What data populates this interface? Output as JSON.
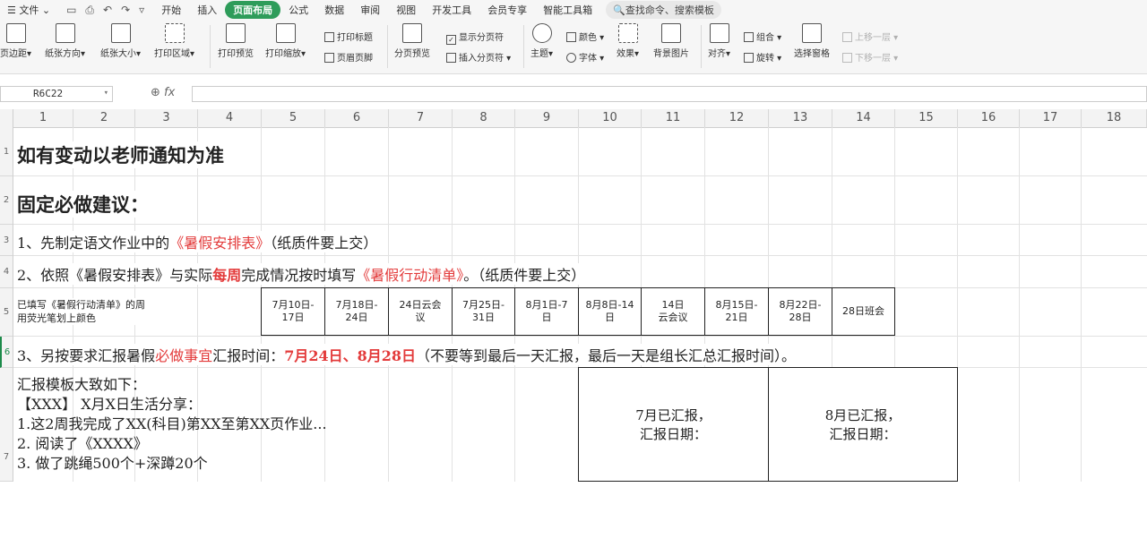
{
  "menu": {
    "file_label": "☰ 文件 ⌄",
    "tabs": [
      "开始",
      "插入",
      "页面布局",
      "公式",
      "数据",
      "审阅",
      "视图",
      "开发工具",
      "会员专享",
      "智能工具箱"
    ],
    "active_tab_index": 2,
    "search_label": "查找命令、搜索模板"
  },
  "ribbon": {
    "margins": "页边距",
    "orientation": "纸张方向",
    "size": "纸张大小",
    "print_area": "打印区域",
    "print_preview": "打印预览",
    "print_scale": "打印缩放",
    "print_titles": "打印标题",
    "header_footer": "页眉页脚",
    "page_break_preview": "分页预览",
    "show_page_breaks": "显示分页符",
    "insert_page_break": "插入分页符",
    "theme": "主题",
    "colors": "颜色",
    "fonts": "字体",
    "effects": "效果",
    "background": "背景图片",
    "align": "对齐",
    "group": "组合",
    "rotate": "旋转",
    "selection_pane": "选择窗格",
    "bring_forward": "上移一层",
    "send_backward": "下移一层"
  },
  "formula_bar": {
    "name_box": "R6C22",
    "fx_label": "fx",
    "formula": ""
  },
  "columns": [
    "1",
    "2",
    "3",
    "4",
    "5",
    "6",
    "7",
    "8",
    "9",
    "10",
    "11",
    "12",
    "13",
    "14",
    "15",
    "16",
    "17",
    "18"
  ],
  "rows": [
    "1",
    "2",
    "3",
    "4",
    "5",
    "6",
    "7"
  ],
  "selected_row": "6",
  "sheet": {
    "r1": "如有变动以老师通知为准",
    "r2": "固定必做建议：",
    "r3_a": "1、先制定语文作业中的",
    "r3_b": "《暑假安排表》",
    "r3_c": "（纸质件要上交）",
    "r4_a": "2、依照《暑假安排表》与实际",
    "r4_b": "每周",
    "r4_c": "完成情况按时填写",
    "r4_d": "《暑假行动清单》",
    "r4_e": "。（纸质件要上交）",
    "r5_label_1": "已填写《暑假行动清单》的周",
    "r5_label_2": "用荧光笔划上颜色",
    "weeks": [
      {
        "l1": "7月10日-",
        "l2": "17日"
      },
      {
        "l1": "7月18日-",
        "l2": "24日"
      },
      {
        "l1": "24日云会",
        "l2": "议"
      },
      {
        "l1": "7月25日-",
        "l2": "31日"
      },
      {
        "l1": "8月1日-7",
        "l2": "日"
      },
      {
        "l1": "8月8日-14",
        "l2": "日"
      },
      {
        "l1": "14日",
        "l2": "云会议"
      },
      {
        "l1": "8月15日-",
        "l2": "21日"
      },
      {
        "l1": "8月22日-",
        "l2": "28日"
      },
      {
        "l1": "28日班会",
        "l2": ""
      }
    ],
    "r6_a": "3、另按要求汇报暑假",
    "r6_b": "必做事宜",
    "r6_c": "汇报时间：",
    "r6_d": "7月24日、8月28日",
    "r6_e": "（不要等到最后一天汇报，最后一天是组长汇总汇报时间）。",
    "r7_lines": [
      "汇报模板大致如下：",
      "【XXX】 X月X日生活分享：",
      "1.这2周我完成了XX(科目)第XX至第XX页作业...",
      "2. 阅读了《XXXX》",
      "3. 做了跳绳500个+深蹲20个"
    ],
    "july_report_1": "7月已汇报，",
    "july_report_2": "汇报日期：",
    "aug_report_1": "8月已汇报，",
    "aug_report_2": "汇报日期："
  }
}
